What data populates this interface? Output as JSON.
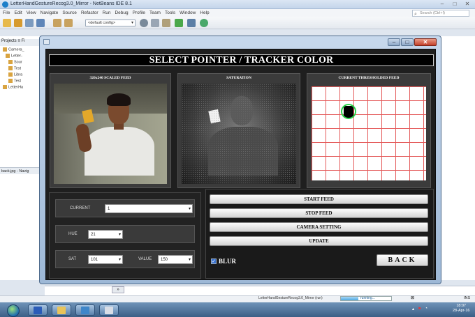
{
  "ide": {
    "title": "LetterHandGestureRecog3.0_Mirror - NetBeans IDE 8.1",
    "menu": [
      "File",
      "Edit",
      "View",
      "Navigate",
      "Source",
      "Refactor",
      "Run",
      "Debug",
      "Profile",
      "Team",
      "Tools",
      "Window",
      "Help"
    ],
    "search_placeholder": "Search (Ctrl+I)",
    "config": "<default config>",
    "projects_tab": "Projects ≡ Fi",
    "projects": [
      "Camera_",
      "Letter-",
      "Sour",
      "Test",
      "Libra",
      "Test",
      "LetterHa"
    ],
    "navigator_tab": "back.jpg - Navig",
    "status_project": "LetterHandGestureRecog3.0_Mirror (run)",
    "progress_text": "running...",
    "progress_fraction": 0.35,
    "status_col": "INS"
  },
  "taskbar": {
    "clock_time": "18:07",
    "clock_date": "28-Apr-16"
  },
  "app": {
    "title": "SELECT POINTER / TRACKER COLOR",
    "feeds": [
      {
        "label": "320x240 SCALED FEED"
      },
      {
        "label": "SATURATION"
      },
      {
        "label": "CURRENT THRESHOLDED FEED"
      }
    ],
    "current": {
      "label": "CURRENT",
      "value": "1"
    },
    "hue": {
      "label": "HUE",
      "value": "21"
    },
    "sat": {
      "label": "SAT",
      "value": "101"
    },
    "value": {
      "label": "VALUE",
      "value": "150"
    },
    "buttons": {
      "start_feed": "START FEED",
      "stop_feed": "STOP FEED",
      "camera_setting": "CAMERA SETTING",
      "update": "UPDATE",
      "back": "BACK"
    },
    "blur_label": "BLUR",
    "blur_checked": true,
    "colors": {
      "tracker_ring": "#2bd14a",
      "threshold_grid": "#e45a5a"
    }
  }
}
